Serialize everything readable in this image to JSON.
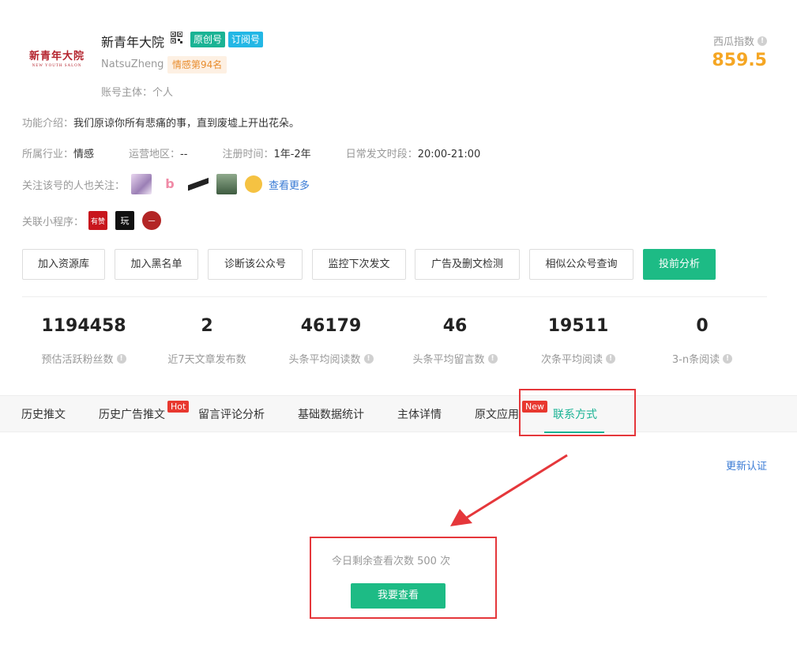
{
  "account": {
    "logo_cn": "新青年大院",
    "logo_en": "NEW YOUTH SALON",
    "name": "新青年大院",
    "badge_original": "原创号",
    "badge_subscription": "订阅号",
    "en_name": "NatsuZheng",
    "rank_tag": "情感第94名",
    "entity": "账号主体：个人"
  },
  "xigua": {
    "label": "西瓜指数",
    "value": "859.5",
    "color": "#f5a623"
  },
  "intro": {
    "label": "功能介绍：",
    "value": "我们原谅你所有悲痛的事，直到废墟上开出花朵。"
  },
  "meta": [
    {
      "label": "所属行业：",
      "value": "情感"
    },
    {
      "label": "运营地区：",
      "value": "--"
    },
    {
      "label": "注册时间：",
      "value": "1年-2年"
    },
    {
      "label": "日常发文时段：",
      "value": "20:00-21:00"
    }
  ],
  "follow": {
    "label": "关注该号的人也关注：",
    "see_more": "查看更多",
    "avatar2_text": "b"
  },
  "mini_programs": {
    "label": "关联小程序：",
    "mp1": "有赞",
    "mp2": "玩",
    "mp3": "一"
  },
  "actions": [
    "加入资源库",
    "加入黑名单",
    "诊断该公众号",
    "监控下次发文",
    "广告及删文检测",
    "相似公众号查询",
    "投前分析"
  ],
  "stats": [
    {
      "value": "1194458",
      "label": "预估活跃粉丝数",
      "info": true
    },
    {
      "value": "2",
      "label": "近7天文章发布数",
      "info": false
    },
    {
      "value": "46179",
      "label": "头条平均阅读数",
      "info": true
    },
    {
      "value": "46",
      "label": "头条平均留言数",
      "info": true
    },
    {
      "value": "19511",
      "label": "次条平均阅读",
      "info": true
    },
    {
      "value": "0",
      "label": "3-n条阅读",
      "info": true
    }
  ],
  "tabs": [
    "历史推文",
    "历史广告推文",
    "留言评论分析",
    "基础数据统计",
    "主体详情",
    "原文应用",
    "联系方式"
  ],
  "tab_tags": {
    "hot": "Hot",
    "new": "New"
  },
  "contact": {
    "update_link": "更新认证",
    "remaining": "今日剩余查看次数 500 次",
    "view_button": "我要查看"
  },
  "colors": {
    "accent": "#1dbb85",
    "highlight": "#e5373b",
    "link": "#3a7bd5"
  }
}
